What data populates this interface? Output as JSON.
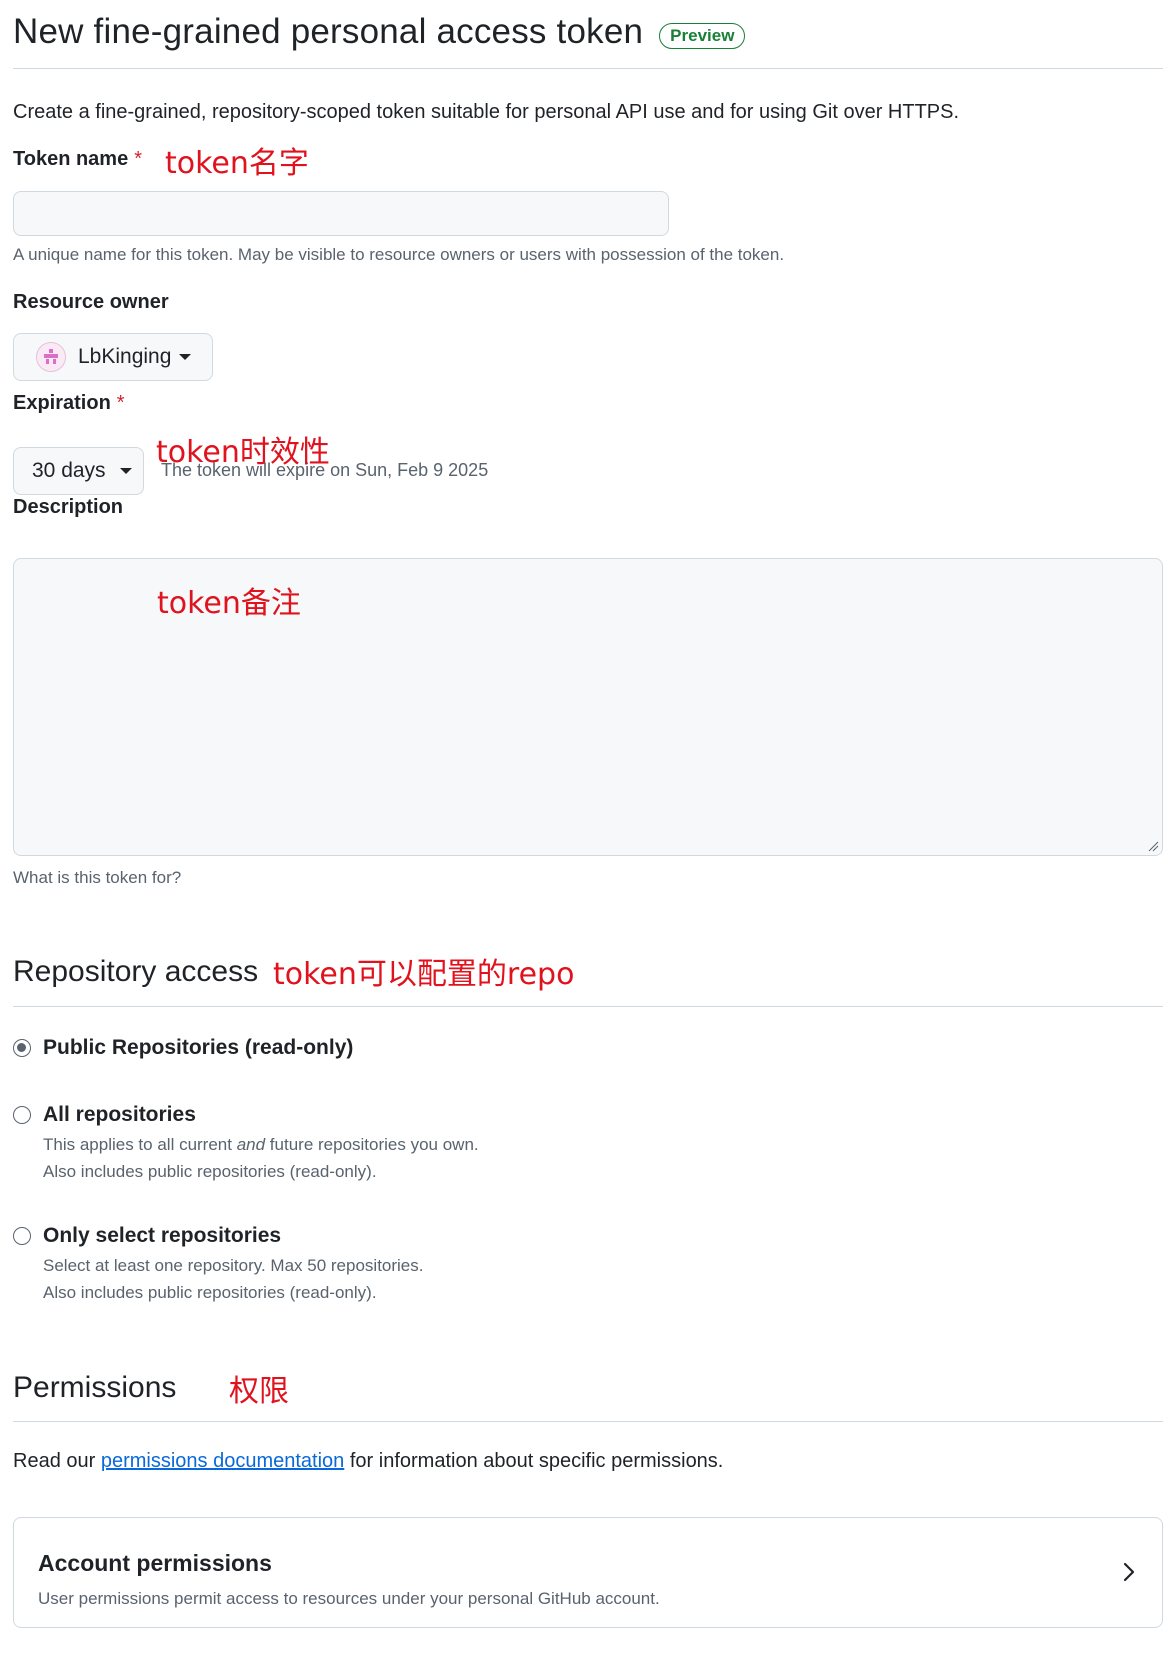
{
  "header": {
    "title": "New fine-grained personal access token",
    "badge": "Preview",
    "intro": "Create a fine-grained, repository-scoped token suitable for personal API use and for using Git over HTTPS."
  },
  "token_name": {
    "label": "Token name",
    "required_mark": "*",
    "value": "",
    "hint": "A unique name for this token. May be visible to resource owners or users with possession of the token."
  },
  "resource_owner": {
    "label": "Resource owner",
    "selected": "LbKinging"
  },
  "expiration": {
    "label": "Expiration",
    "required_mark": "*",
    "selected": "30 days",
    "note": "The token will expire on Sun, Feb 9 2025"
  },
  "description": {
    "label": "Description",
    "value": "",
    "hint": "What is this token for?"
  },
  "repository_access": {
    "title": "Repository access",
    "options": [
      {
        "label": "Public Repositories (read-only)",
        "checked": true,
        "desc1": "",
        "desc2": ""
      },
      {
        "label": "All repositories",
        "checked": false,
        "desc1_pre": "This applies to all current ",
        "desc1_em": "and",
        "desc1_post": " future repositories you own.",
        "desc2": "Also includes public repositories (read-only)."
      },
      {
        "label": "Only select repositories",
        "checked": false,
        "desc1": "Select at least one repository. Max 50 repositories.",
        "desc2": "Also includes public repositories (read-only)."
      }
    ]
  },
  "permissions": {
    "title": "Permissions",
    "text_pre": "Read our ",
    "link": "permissions documentation",
    "text_post": " for information about specific permissions.",
    "account": {
      "title": "Account permissions",
      "desc": "User permissions permit access to resources under your personal GitHub account."
    }
  },
  "annotations": {
    "token_name": "token名字",
    "expiration": "token时效性",
    "description": "token备注",
    "repository": "token可以配置的repo",
    "permissions": "权限"
  },
  "colors": {
    "annotation": "#e0121d",
    "badge": "#1a7f37",
    "link": "#0969da",
    "border": "#d1d9e0",
    "input_bg": "#f6f8fa"
  },
  "icons": [
    "chevron-down-icon",
    "chevron-right-icon",
    "resize-grip-icon",
    "avatar"
  ]
}
